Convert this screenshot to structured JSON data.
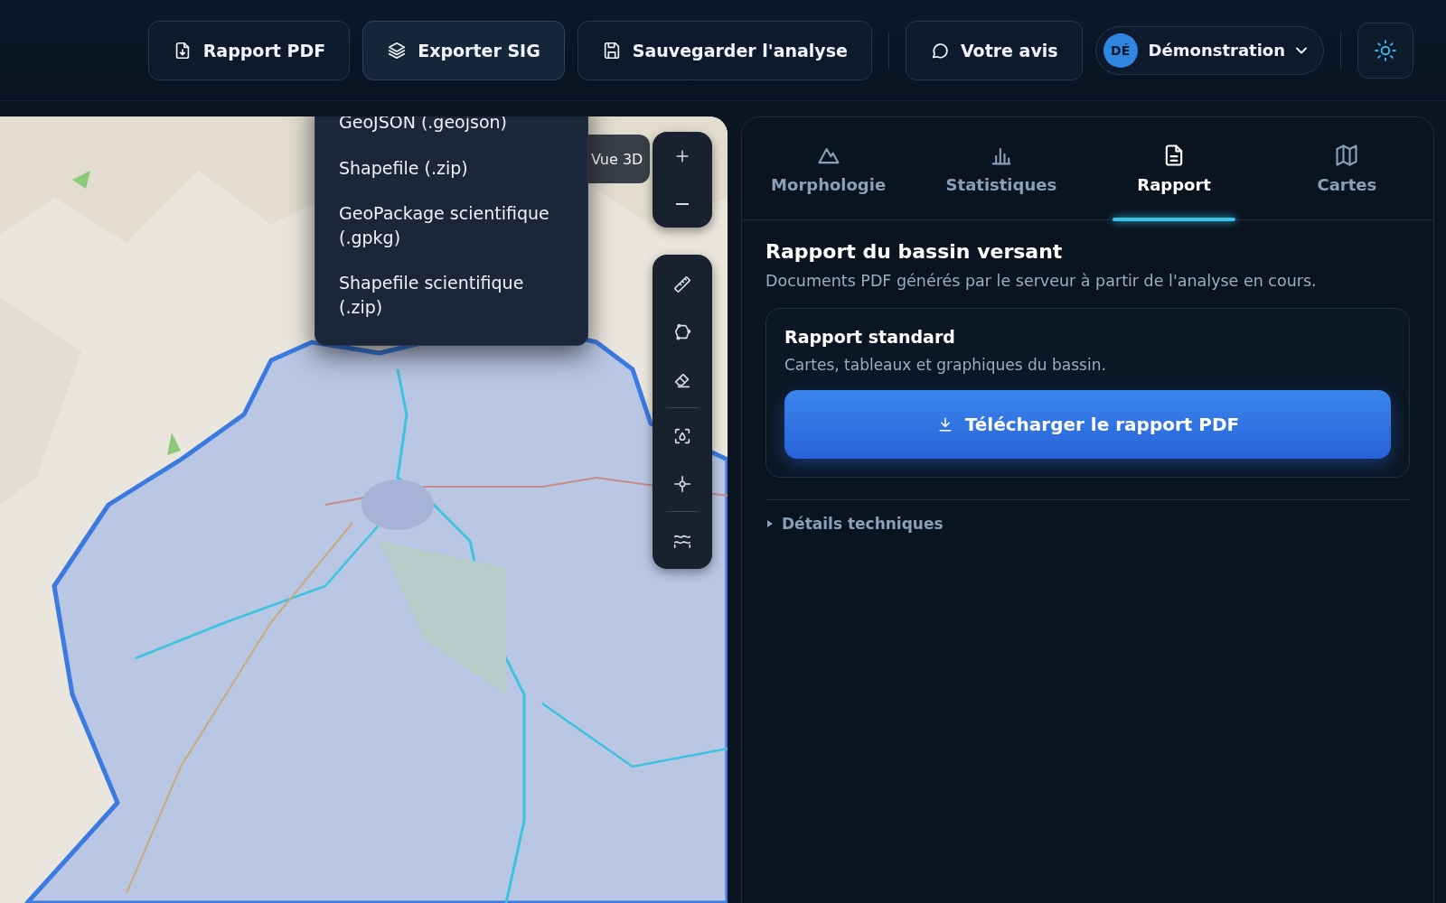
{
  "toolbar": {
    "buttons": [
      {
        "label": "Rapport PDF",
        "kind": "pdf",
        "selected": false
      },
      {
        "label": "Exporter SIG",
        "kind": "layers",
        "selected": true
      },
      {
        "label": "Sauvegarder l'analyse",
        "kind": "save",
        "selected": false
      },
      {
        "label": "Votre avis",
        "kind": "comment",
        "selected": false
      }
    ],
    "user": {
      "initials": "DÉ",
      "name": "Démonstration"
    }
  },
  "export_menu": {
    "items": [
      "GeoJSON (.geojson)",
      "Shapefile (.zip)",
      "GeoPackage scientifique (.gpkg)",
      "Shapefile scientifique (.zip)"
    ]
  },
  "map": {
    "view_toggle": {
      "label": "Vue 3D"
    },
    "controls": [
      {
        "kind": "zoom-in"
      },
      {
        "kind": "zoom-out"
      }
    ],
    "tools": [
      {
        "kind": "ruler"
      },
      {
        "kind": "polygon"
      },
      {
        "kind": "eraser"
      },
      {
        "kind": "watershed"
      },
      {
        "kind": "locate"
      },
      {
        "kind": "rivers"
      }
    ]
  },
  "panel": {
    "tabs": [
      {
        "label": "Morphologie",
        "kind": "mountain",
        "selected": false
      },
      {
        "label": "Statistiques",
        "kind": "bars",
        "selected": false
      },
      {
        "label": "Rapport",
        "kind": "doc",
        "selected": true
      },
      {
        "label": "Cartes",
        "kind": "map",
        "selected": false
      }
    ],
    "title": "Rapport du bassin versant",
    "subtitle": "Documents PDF générés par le serveur à partir de l'analyse en cours.",
    "card": {
      "title": "Rapport standard",
      "text": "Cartes, tableaux et graphiques du bassin.",
      "button": "Télécharger le rapport PDF"
    },
    "details": {
      "label": "Détails techniques",
      "expanded": false
    }
  }
}
